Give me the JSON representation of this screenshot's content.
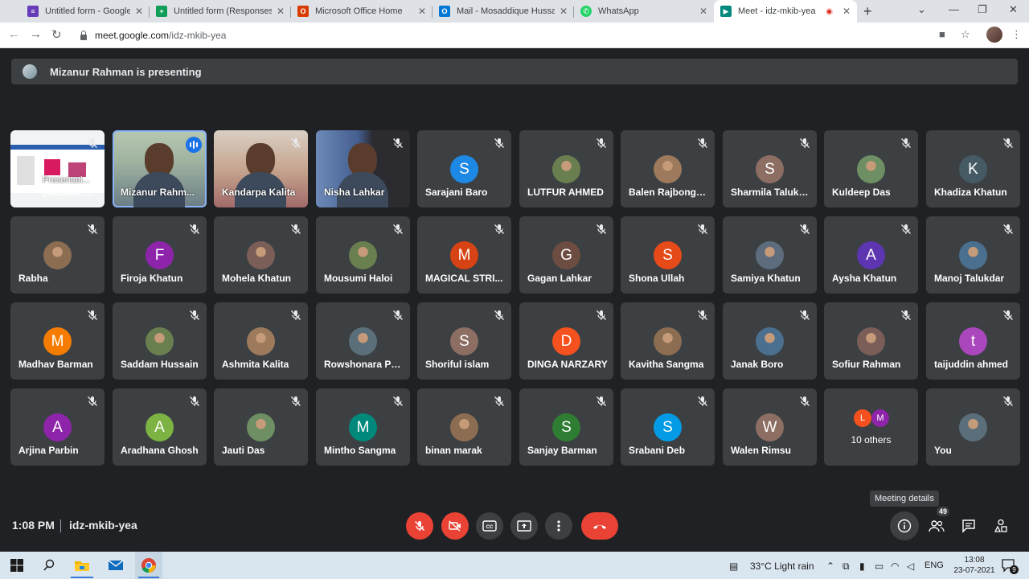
{
  "browser": {
    "tabs": [
      {
        "title": "Untitled form - Google Forms",
        "icon": "google-forms-icon",
        "color": "#673ab7"
      },
      {
        "title": "Untitled form (Responses) - Google Sheets",
        "icon": "google-sheets-icon",
        "color": "#0f9d58"
      },
      {
        "title": "Microsoft Office Home",
        "icon": "office-icon",
        "color": "#d83b01"
      },
      {
        "title": "Mail - Mosaddique Hussain - Outlook",
        "icon": "outlook-icon",
        "color": "#0078d4"
      },
      {
        "title": "WhatsApp",
        "icon": "whatsapp-icon",
        "color": "#25d366"
      },
      {
        "title": "Meet - idz-mkib-yea",
        "icon": "meet-icon",
        "color": "#00897b"
      }
    ],
    "url_host": "meet.google.com",
    "url_path": "/idz-mkib-yea"
  },
  "meet": {
    "presenting_text": "Mizanur Rahman is presenting",
    "participants": [
      {
        "name": "(Mizanur ...",
        "type": "presentation",
        "overlay": "Presentati..."
      },
      {
        "name": "Mizanur Rahm...",
        "type": "video",
        "speaking": true
      },
      {
        "name": "Kandarpa Kalita",
        "type": "video"
      },
      {
        "name": "Nisha Lahkar",
        "type": "video"
      },
      {
        "name": "Sarajani Baro",
        "type": "letter",
        "letter": "S",
        "color": "#1e88e5"
      },
      {
        "name": "LUTFUR AHMED",
        "type": "photo"
      },
      {
        "name": "Balen Rajbongshi",
        "type": "photo"
      },
      {
        "name": "Sharmila Talukd...",
        "type": "letter",
        "letter": "S",
        "color": "#8d6e63"
      },
      {
        "name": "Kuldeep Das",
        "type": "photo"
      },
      {
        "name": "Khadiza Khatun",
        "type": "letter",
        "letter": "K",
        "color": "#455a64"
      },
      {
        "name": "Rabha",
        "type": "photo"
      },
      {
        "name": "Firoja Khatun",
        "type": "letter",
        "letter": "F",
        "color": "#8e24aa"
      },
      {
        "name": "Mohela Khatun",
        "type": "photo"
      },
      {
        "name": "Mousumi Haloi",
        "type": "photo"
      },
      {
        "name": "MAGICAL STRI...",
        "type": "letter",
        "letter": "M",
        "color": "#d84315"
      },
      {
        "name": "Gagan Lahkar",
        "type": "letter",
        "letter": "G",
        "color": "#6d4c41"
      },
      {
        "name": "Shona Ullah",
        "type": "letter",
        "letter": "S",
        "color": "#e64a19"
      },
      {
        "name": "Samiya Khatun",
        "type": "photo"
      },
      {
        "name": "Aysha Khatun",
        "type": "letter",
        "letter": "A",
        "color": "#5e35b1"
      },
      {
        "name": "Manoj Talukdar",
        "type": "photo"
      },
      {
        "name": "Madhav Barman",
        "type": "letter",
        "letter": "M",
        "color": "#f57c00"
      },
      {
        "name": "Saddam Hussain",
        "type": "photo"
      },
      {
        "name": "Ashmita Kalita",
        "type": "photo"
      },
      {
        "name": "Rowshonara Pa...",
        "type": "photo"
      },
      {
        "name": "Shoriful islam",
        "type": "letter",
        "letter": "S",
        "color": "#8d6e63"
      },
      {
        "name": "DINGA NARZARY",
        "type": "letter",
        "letter": "D",
        "color": "#f4511e"
      },
      {
        "name": "Kavitha Sangma",
        "type": "photo"
      },
      {
        "name": "Janak Boro",
        "type": "photo"
      },
      {
        "name": "Sofiur Rahman",
        "type": "photo"
      },
      {
        "name": "taijuddin ahmed",
        "type": "letter",
        "letter": "t",
        "color": "#ab47bc"
      },
      {
        "name": "Arjina Parbin",
        "type": "letter",
        "letter": "A",
        "color": "#8e24aa"
      },
      {
        "name": "Aradhana Ghosh",
        "type": "letter",
        "letter": "A",
        "color": "#7cb342"
      },
      {
        "name": "Jauti Das",
        "type": "photo"
      },
      {
        "name": "Mintho Sangma",
        "type": "letter",
        "letter": "M",
        "color": "#00897b"
      },
      {
        "name": "binan marak",
        "type": "photo"
      },
      {
        "name": "Sanjay Barman",
        "type": "letter",
        "letter": "S",
        "color": "#2e7d32"
      },
      {
        "name": "Srabani Deb",
        "type": "letter",
        "letter": "S",
        "color": "#039be5"
      },
      {
        "name": "Walen Rimsu",
        "type": "letter",
        "letter": "W",
        "color": "#8d6e63"
      },
      {
        "name": "10 others",
        "type": "others",
        "letters": [
          "L",
          "M"
        ],
        "colors": [
          "#f4511e",
          "#8e24aa"
        ]
      },
      {
        "name": "You",
        "type": "photo"
      }
    ],
    "time": "1:08 PM",
    "meeting_code": "idz-mkib-yea",
    "tooltip": "Meeting details",
    "participant_count": "49"
  },
  "taskbar": {
    "weather": "33°C  Light rain",
    "lang": "ENG",
    "time": "13:08",
    "date": "23-07-2021",
    "notif_count": "9"
  }
}
